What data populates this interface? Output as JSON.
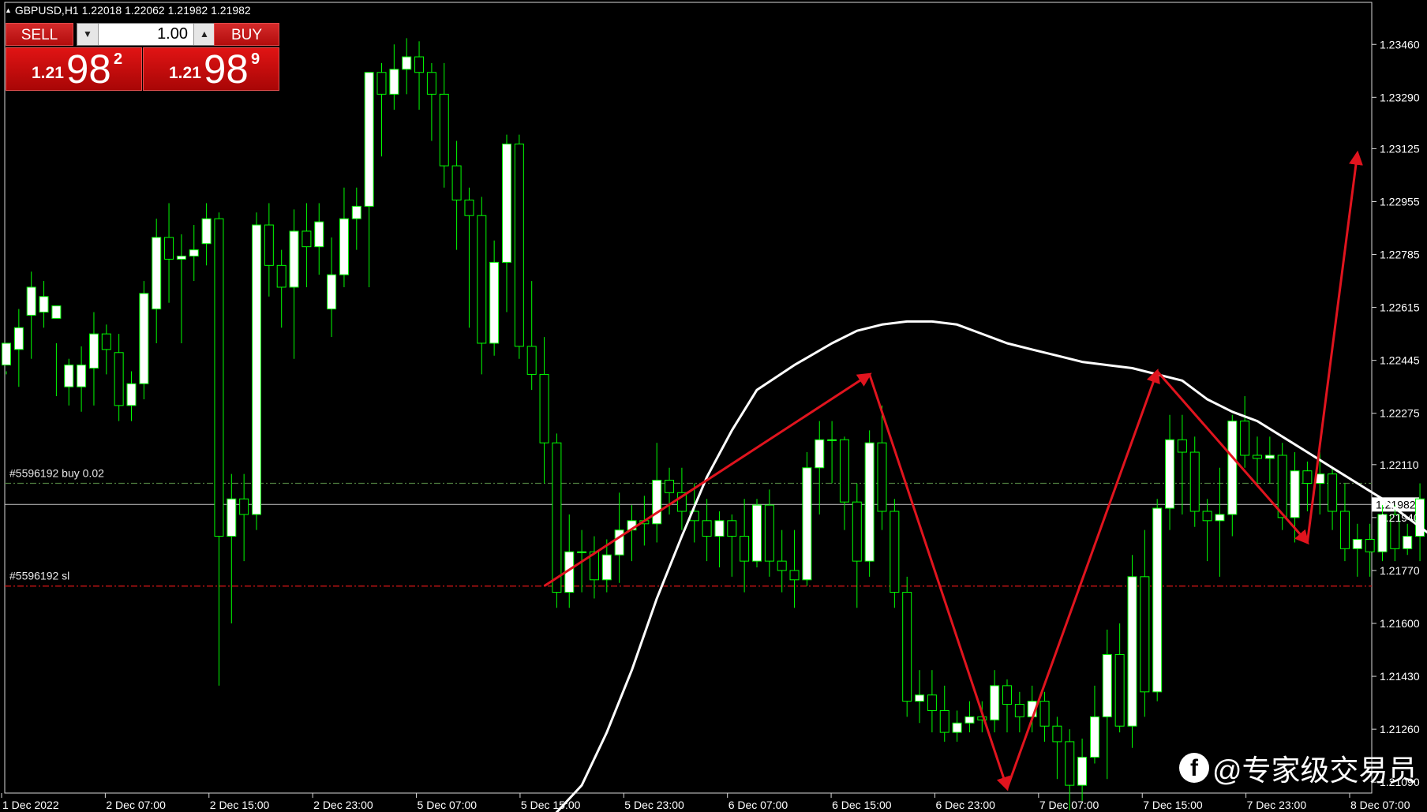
{
  "header": {
    "text": "GBPUSD,H1  1.22018 1.22062 1.21982 1.21982"
  },
  "trade_panel": {
    "sell_label": "SELL",
    "buy_label": "BUY",
    "lot_value": "1.00",
    "sell_price": {
      "small": "1.21",
      "big": "98",
      "sup": "2"
    },
    "buy_price": {
      "small": "1.21",
      "big": "98",
      "sup": "9"
    }
  },
  "watermark": "@专家级交易员",
  "colors": {
    "background": "#000000",
    "bull_fill": "#ffffff",
    "outline": "#00ff00",
    "ma": "#ffffff",
    "arrow": "#e0141e",
    "order_line": "#4f7d3f",
    "sl_line": "#cc1414"
  },
  "chart_data": {
    "type": "candlestick",
    "symbol": "GBPUSD,H1",
    "ylim": [
      1.21055,
      1.23595
    ],
    "y_ticks": [
      "1.23460",
      "1.23290",
      "1.23125",
      "1.22955",
      "1.22785",
      "1.22615",
      "1.22445",
      "1.22275",
      "1.22110",
      "1.21940",
      "1.21770",
      "1.21600",
      "1.21430",
      "1.21260",
      "1.21090"
    ],
    "x_ticks": [
      "1 Dec 2022",
      "2 Dec 07:00",
      "2 Dec 15:00",
      "2 Dec 23:00",
      "5 Dec 07:00",
      "5 Dec 15:00",
      "5 Dec 23:00",
      "6 Dec 07:00",
      "6 Dec 15:00",
      "6 Dec 23:00",
      "7 Dec 07:00",
      "7 Dec 15:00",
      "7 Dec 23:00",
      "8 Dec 07:00"
    ],
    "current_price": "1.21982",
    "order_lines": [
      {
        "label": "#5596192 buy 0.02",
        "price": 1.2205,
        "style": "dash-dot"
      },
      {
        "label": "#5596192 sl",
        "price": 1.2172,
        "style": "dash-dot"
      }
    ],
    "candles": [
      [
        1.2243,
        1.225,
        1.224,
        1.2241
      ],
      [
        1.2248,
        1.2255,
        1.2236,
        1.2261
      ],
      [
        1.2259,
        1.2268,
        1.2245,
        1.2273
      ],
      [
        1.226,
        1.2265,
        1.2255,
        1.227
      ],
      [
        1.2258,
        1.2262,
        1.2233,
        1.225
      ],
      [
        1.2236,
        1.2243,
        1.223,
        1.2245
      ],
      [
        1.2236,
        1.2243,
        1.2228,
        1.2249
      ],
      [
        1.2242,
        1.2253,
        1.223,
        1.226
      ],
      [
        1.2253,
        1.2248,
        1.224,
        1.2256
      ],
      [
        1.2247,
        1.223,
        1.2225,
        1.2253
      ],
      [
        1.223,
        1.2237,
        1.2225,
        1.2241
      ],
      [
        1.2237,
        1.2266,
        1.2232,
        1.227
      ],
      [
        1.2261,
        1.2284,
        1.225,
        1.229
      ],
      [
        1.2284,
        1.2277,
        1.2263,
        1.2295
      ],
      [
        1.2277,
        1.2278,
        1.225,
        1.2285
      ],
      [
        1.2278,
        1.228,
        1.227,
        1.2288
      ],
      [
        1.2282,
        1.229,
        1.2275,
        1.2295
      ],
      [
        1.229,
        1.2188,
        1.214,
        1.2292
      ],
      [
        1.2188,
        1.22,
        1.216,
        1.2208
      ],
      [
        1.22,
        1.2195,
        1.218,
        1.2208
      ],
      [
        1.2195,
        1.2288,
        1.219,
        1.2292
      ],
      [
        1.2288,
        1.2275,
        1.2265,
        1.2295
      ],
      [
        1.2275,
        1.2268,
        1.2255,
        1.228
      ],
      [
        1.2268,
        1.2286,
        1.2245,
        1.2293
      ],
      [
        1.2286,
        1.2281,
        1.2268,
        1.2295
      ],
      [
        1.2281,
        1.2289,
        1.2272,
        1.2295
      ],
      [
        1.2261,
        1.2272,
        1.2252,
        1.2284
      ],
      [
        1.2272,
        1.229,
        1.2268,
        1.23
      ],
      [
        1.229,
        1.2294,
        1.228,
        1.23
      ],
      [
        1.2294,
        1.2337,
        1.2268,
        1.2336
      ],
      [
        1.2337,
        1.233,
        1.231,
        1.234
      ],
      [
        1.233,
        1.2338,
        1.2325,
        1.2346
      ],
      [
        1.2338,
        1.2342,
        1.233,
        1.2348
      ],
      [
        1.2342,
        1.2337,
        1.2325,
        1.2347
      ],
      [
        1.2337,
        1.233,
        1.2315,
        1.234
      ],
      [
        1.233,
        1.2307,
        1.23,
        1.234
      ],
      [
        1.2307,
        1.2296,
        1.228,
        1.2315
      ],
      [
        1.2296,
        1.2291,
        1.2255,
        1.23
      ],
      [
        1.2291,
        1.225,
        1.224,
        1.2297
      ],
      [
        1.225,
        1.2276,
        1.2246,
        1.2283
      ],
      [
        1.2276,
        1.2314,
        1.226,
        1.2317
      ],
      [
        1.2314,
        1.2249,
        1.2245,
        1.2317
      ],
      [
        1.2249,
        1.224,
        1.2235,
        1.227
      ],
      [
        1.224,
        1.2218,
        1.2205,
        1.2252
      ],
      [
        1.2218,
        1.217,
        1.2165,
        1.2221
      ],
      [
        1.217,
        1.2183,
        1.2165,
        1.2195
      ],
      [
        1.2183,
        1.2183,
        1.217,
        1.219
      ],
      [
        1.2183,
        1.2174,
        1.2168,
        1.2188
      ],
      [
        1.2174,
        1.2182,
        1.217,
        1.2187
      ],
      [
        1.2182,
        1.219,
        1.2173,
        1.2202
      ],
      [
        1.219,
        1.2193,
        1.218,
        1.2198
      ],
      [
        1.2193,
        1.2192,
        1.2185,
        1.2201
      ],
      [
        1.2192,
        1.2206,
        1.2186,
        1.2218
      ],
      [
        1.2206,
        1.2202,
        1.2195,
        1.221
      ],
      [
        1.2202,
        1.2196,
        1.219,
        1.221
      ],
      [
        1.2196,
        1.2193,
        1.2186,
        1.2205
      ],
      [
        1.2193,
        1.2188,
        1.218,
        1.22
      ],
      [
        1.2188,
        1.2193,
        1.2178,
        1.2196
      ],
      [
        1.2193,
        1.2188,
        1.2175,
        1.2195
      ],
      [
        1.2188,
        1.218,
        1.217,
        1.22
      ],
      [
        1.218,
        1.2198,
        1.2178,
        1.22
      ],
      [
        1.2198,
        1.218,
        1.2175,
        1.2203
      ],
      [
        1.218,
        1.2177,
        1.217,
        1.219
      ],
      [
        1.2177,
        1.2174,
        1.2165,
        1.219
      ],
      [
        1.2174,
        1.221,
        1.2172,
        1.2215
      ],
      [
        1.221,
        1.2219,
        1.2195,
        1.2225
      ],
      [
        1.2219,
        1.2219,
        1.2205,
        1.2225
      ],
      [
        1.2219,
        1.2199,
        1.219,
        1.222
      ],
      [
        1.2199,
        1.218,
        1.2165,
        1.2205
      ],
      [
        1.218,
        1.2218,
        1.2175,
        1.2222
      ],
      [
        1.2218,
        1.2196,
        1.219,
        1.223
      ],
      [
        1.2196,
        1.217,
        1.2165,
        1.22
      ],
      [
        1.217,
        1.2135,
        1.213,
        1.2175
      ],
      [
        1.2135,
        1.2137,
        1.2128,
        1.2145
      ],
      [
        1.2137,
        1.2132,
        1.2125,
        1.2145
      ],
      [
        1.2132,
        1.2125,
        1.2122,
        1.214
      ],
      [
        1.2125,
        1.2128,
        1.2122,
        1.2132
      ],
      [
        1.2128,
        1.213,
        1.2125,
        1.2135
      ],
      [
        1.213,
        1.2129,
        1.2125,
        1.2135
      ],
      [
        1.2129,
        1.214,
        1.2125,
        1.2145
      ],
      [
        1.214,
        1.2134,
        1.2125,
        1.2142
      ],
      [
        1.2134,
        1.213,
        1.2125,
        1.2138
      ],
      [
        1.213,
        1.2135,
        1.2125,
        1.214
      ],
      [
        1.2135,
        1.2127,
        1.2122,
        1.2138
      ],
      [
        1.2127,
        1.2122,
        1.211,
        1.213
      ],
      [
        1.2122,
        1.2108,
        1.21,
        1.2126
      ],
      [
        1.2108,
        1.2117,
        1.2103,
        1.2123
      ],
      [
        1.2117,
        1.213,
        1.2115,
        1.214
      ],
      [
        1.213,
        1.215,
        1.211,
        1.2158
      ],
      [
        1.215,
        1.2127,
        1.2125,
        1.216
      ],
      [
        1.2127,
        1.2175,
        1.212,
        1.2182
      ],
      [
        1.2175,
        1.2138,
        1.213,
        1.219
      ],
      [
        1.2138,
        1.2197,
        1.2135,
        1.22
      ],
      [
        1.2197,
        1.2219,
        1.219,
        1.2227
      ],
      [
        1.2219,
        1.2215,
        1.2195,
        1.2227
      ],
      [
        1.2215,
        1.2196,
        1.2191,
        1.222
      ],
      [
        1.2196,
        1.2193,
        1.218,
        1.22
      ],
      [
        1.2193,
        1.2195,
        1.2175,
        1.221
      ],
      [
        1.2195,
        1.2225,
        1.2188,
        1.2227
      ],
      [
        1.2225,
        1.2214,
        1.221,
        1.2233
      ],
      [
        1.2214,
        1.2213,
        1.2205,
        1.222
      ],
      [
        1.2213,
        1.2214,
        1.2205,
        1.222
      ],
      [
        1.2214,
        1.2194,
        1.219,
        1.2218
      ],
      [
        1.2194,
        1.2209,
        1.2186,
        1.2215
      ],
      [
        1.2209,
        1.2205,
        1.2196,
        1.2212
      ],
      [
        1.2205,
        1.2208,
        1.2195,
        1.2215
      ],
      [
        1.2208,
        1.2196,
        1.219,
        1.221
      ],
      [
        1.2196,
        1.2184,
        1.218,
        1.2205
      ],
      [
        1.2184,
        1.2187,
        1.2175,
        1.2192
      ],
      [
        1.2187,
        1.2183,
        1.2175,
        1.2192
      ],
      [
        1.2183,
        1.2195,
        1.218,
        1.2198
      ],
      [
        1.2195,
        1.2184,
        1.218,
        1.2198
      ],
      [
        1.2184,
        1.2188,
        1.2182,
        1.2192
      ],
      [
        1.2188,
        1.22,
        1.218,
        1.2205
      ],
      [
        1.22,
        1.2197,
        1.219,
        1.2206
      ]
    ],
    "ma_points": [
      [
        43,
        1.2095
      ],
      [
        46,
        1.2108
      ],
      [
        48,
        1.2125
      ],
      [
        50,
        1.2145
      ],
      [
        52,
        1.2168
      ],
      [
        54,
        1.2188
      ],
      [
        56,
        1.2207
      ],
      [
        58,
        1.2222
      ],
      [
        60,
        1.2235
      ],
      [
        63,
        1.2243
      ],
      [
        66,
        1.225
      ],
      [
        68,
        1.2254
      ],
      [
        70,
        1.2256
      ],
      [
        72,
        1.2257
      ],
      [
        74,
        1.2257
      ],
      [
        76,
        1.2256
      ],
      [
        78,
        1.2253
      ],
      [
        80,
        1.225
      ],
      [
        82,
        1.2248
      ],
      [
        84,
        1.2246
      ],
      [
        86,
        1.2244
      ],
      [
        88,
        1.2243
      ],
      [
        90,
        1.2242
      ],
      [
        92,
        1.224
      ],
      [
        94,
        1.2238
      ],
      [
        96,
        1.2232
      ],
      [
        98,
        1.2228
      ],
      [
        100,
        1.2225
      ],
      [
        102,
        1.222
      ],
      [
        104,
        1.2215
      ],
      [
        106,
        1.221
      ],
      [
        108,
        1.2205
      ],
      [
        110,
        1.22
      ],
      [
        112,
        1.2194
      ],
      [
        114,
        1.2188
      ],
      [
        116,
        1.2183
      ],
      [
        118,
        1.218
      ],
      [
        120,
        1.2178
      ],
      [
        122,
        1.2177
      ],
      [
        124,
        1.2177
      ],
      [
        126,
        1.2178
      ],
      [
        127,
        1.2179
      ]
    ],
    "annotations": {
      "zigzag": [
        [
          43,
          1.2172
        ],
        [
          69,
          1.224
        ],
        [
          80,
          1.2107
        ],
        [
          92,
          1.2241
        ],
        [
          104,
          1.2186
        ],
        [
          108,
          1.2311
        ]
      ]
    }
  }
}
